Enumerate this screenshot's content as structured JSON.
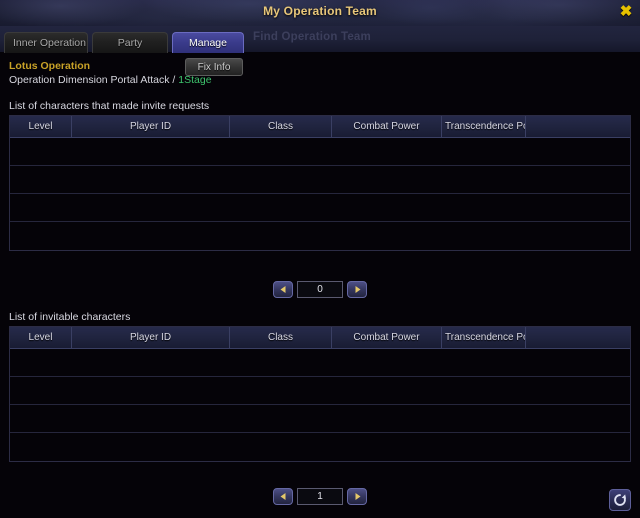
{
  "window": {
    "title": "My Operation Team",
    "ghost_title": "Find Operation Team",
    "close_icon": "close-icon"
  },
  "tabs": [
    {
      "label": "Inner Operation T",
      "active": false
    },
    {
      "label": "Party",
      "active": false
    },
    {
      "label": "Manage",
      "active": true
    }
  ],
  "operation": {
    "name": "Lotus Operation",
    "description": "Operation Dimension Portal Attack /",
    "stage": "1Stage",
    "fix_info_label": "Fix Info"
  },
  "columns": [
    "Level",
    "Player ID",
    "Class",
    "Combat Power",
    "Transcendence Pow"
  ],
  "requests_section": {
    "caption": "List of characters that made invite requests",
    "rows": [
      [],
      [],
      [],
      []
    ],
    "pager": {
      "prev_icon": "arrow-left-icon",
      "next_icon": "arrow-right-icon",
      "value": "0"
    }
  },
  "invitable_section": {
    "caption": "List of invitable characters",
    "rows": [
      [],
      [],
      [],
      []
    ],
    "pager": {
      "prev_icon": "arrow-left-icon",
      "next_icon": "arrow-right-icon",
      "value": "1"
    }
  },
  "refresh": {
    "icon": "refresh-icon"
  },
  "colors": {
    "accent_gold": "#c9a227",
    "stage_green": "#3ec46d",
    "tab_active": "#3b3c8c",
    "close": "#e6c100"
  }
}
